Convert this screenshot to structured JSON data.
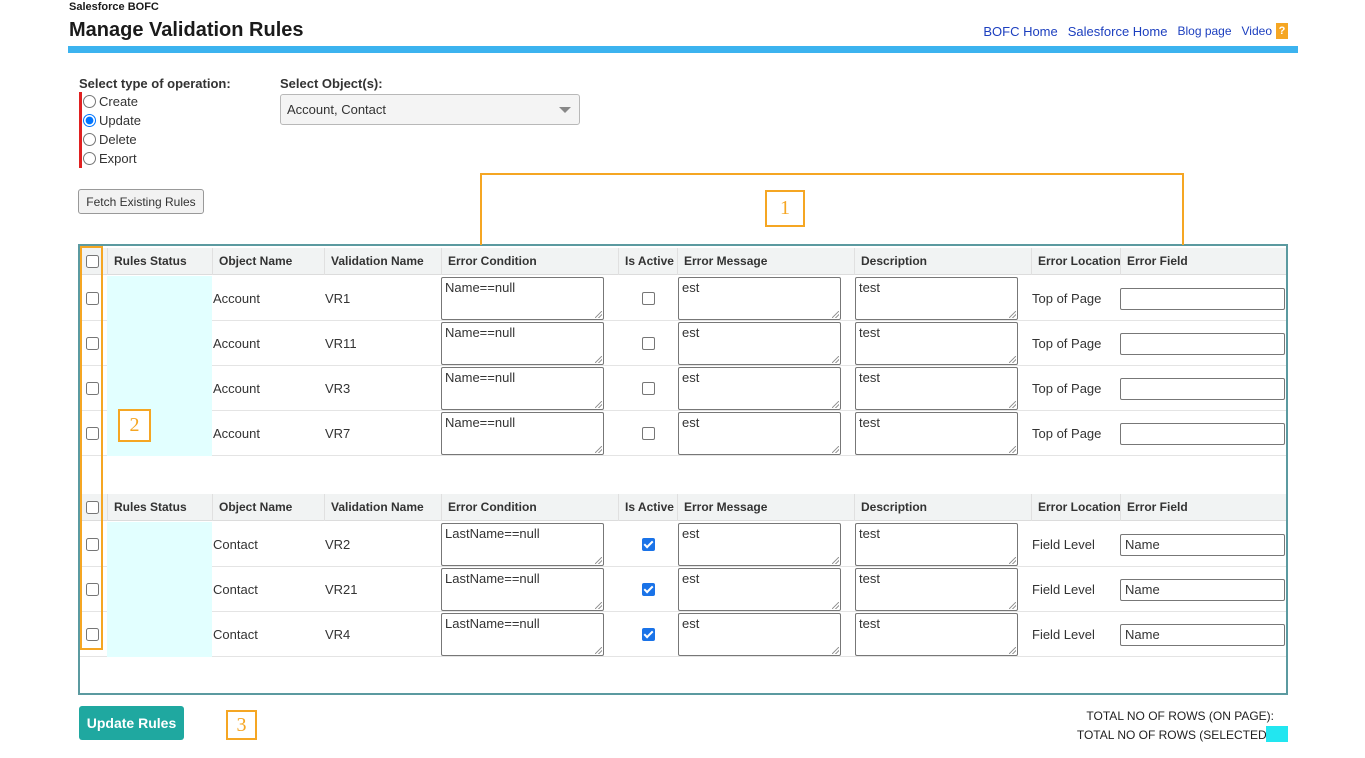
{
  "header": {
    "app_name": "Salesforce BOFC",
    "title": "Manage Validation Rules",
    "links": [
      "BOFC Home",
      "Salesforce Home",
      "Blog page",
      "Video"
    ],
    "help_glyph": "?",
    "bar_color": "#3cb3ef"
  },
  "operation": {
    "label": "Select type of operation:",
    "options": [
      "Create",
      "Update",
      "Delete",
      "Export"
    ],
    "selected": "Update"
  },
  "objects": {
    "label": "Select Object(s):",
    "value": "Account, Contact"
  },
  "fetch_button": "Fetch Existing Rules",
  "columns": [
    "Rules Status",
    "Object Name",
    "Validation Name",
    "Error Condition",
    "Is Active",
    "Error Message",
    "Description",
    "Error Location",
    "Error Field"
  ],
  "groups": [
    {
      "rows": [
        {
          "object": "Account",
          "name": "VR1",
          "condition": "Name==null",
          "active": false,
          "message": "est",
          "description": "test",
          "location": "Top of Page",
          "field": ""
        },
        {
          "object": "Account",
          "name": "VR11",
          "condition": "Name==null",
          "active": false,
          "message": "est",
          "description": "test",
          "location": "Top of Page",
          "field": ""
        },
        {
          "object": "Account",
          "name": "VR3",
          "condition": "Name==null",
          "active": false,
          "message": "est",
          "description": "test",
          "location": "Top of Page",
          "field": ""
        },
        {
          "object": "Account",
          "name": "VR7",
          "condition": "Name==null",
          "active": false,
          "message": "est",
          "description": "test",
          "location": "Top of Page",
          "field": ""
        }
      ]
    },
    {
      "rows": [
        {
          "object": "Contact",
          "name": "VR2",
          "condition": "LastName==null",
          "active": true,
          "message": "est",
          "description": "test",
          "location": "Field Level",
          "field": "Name"
        },
        {
          "object": "Contact",
          "name": "VR21",
          "condition": "LastName==null",
          "active": true,
          "message": "est",
          "description": "test",
          "location": "Field Level",
          "field": "Name"
        },
        {
          "object": "Contact",
          "name": "VR4",
          "condition": "LastName==null",
          "active": true,
          "message": "est",
          "description": "test",
          "location": "Field Level",
          "field": "Name"
        }
      ]
    }
  ],
  "annotations": [
    "1",
    "2",
    "3"
  ],
  "update_button": "Update Rules",
  "totals": {
    "on_page_label": "TOTAL NO OF ROWS (ON PAGE):",
    "selected_label": "TOTAL NO OF ROWS (SELECTED):",
    "selected_color": "#22e6f0"
  }
}
